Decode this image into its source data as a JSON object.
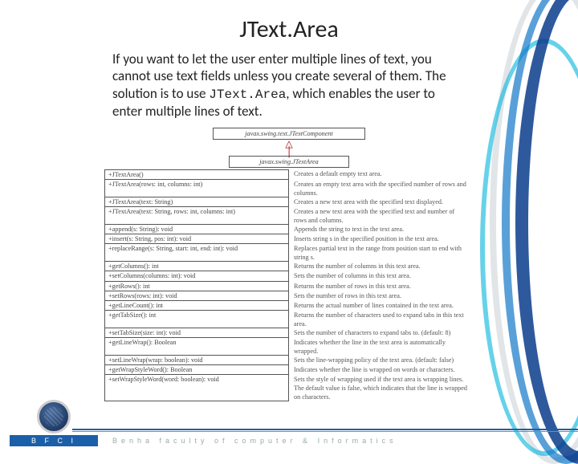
{
  "title": "JText.Area",
  "description_pre": "If you want to let the user enter multiple lines of text, you cannot use text fields unless you create several of them.  The solution is to use ",
  "description_code": "JText.Area",
  "description_post": ", which enables the user to enter multiple lines of text.",
  "superclass": "javax.swing.text.JTextComponent",
  "classname": "javax.swing.JTextArea",
  "uml_header": "JTextArea",
  "rows": [
    {
      "sig": "+JTextArea()",
      "desc": "Creates a default empty text area."
    },
    {
      "sig": "+JTextArea(rows: int, columns: int)",
      "desc": "Creates an empty text area with the specified number of rows and columns."
    },
    {
      "sig": "+JTextArea(text: String)",
      "desc": "Creates a new text area with the specified text displayed."
    },
    {
      "sig": "+JTextArea(text: String, rows: int, columns: int)",
      "desc": "Creates a new text area with the specified text and number of rows and columns."
    },
    {
      "sig": "+append(s: String): void",
      "desc": "Appends the string to text in the text area."
    },
    {
      "sig": "+insert(s: String, pos: int): void",
      "desc": "Inserts string s in the specified position in the text area."
    },
    {
      "sig": "+replaceRange(s: String, start: int, end: int): void",
      "desc": "Replaces partial text in the range from position start to end with string s."
    },
    {
      "sig": "+getColumns(): int",
      "desc": "Returns the number of columns in this text area."
    },
    {
      "sig": "+setColumns(columns: int): void",
      "desc": "Sets the number of columns in this text area."
    },
    {
      "sig": "+getRows(): int",
      "desc": "Returns the number of rows in this text area."
    },
    {
      "sig": "+setRows(rows: int): void",
      "desc": "Sets the number of rows in this text area."
    },
    {
      "sig": "+getLineCount(): int",
      "desc": "Returns the actual number of lines contained in the text area."
    },
    {
      "sig": "+getTabSize(): int",
      "desc": "Returns the number of characters used to expand tabs in this text area."
    },
    {
      "sig": "+setTabSize(size: int): void",
      "desc": "Sets the number of characters to expand tabs to. (default: 8)"
    },
    {
      "sig": "+getLineWrap(): Boolean",
      "desc": "Indicates whether the line in the text area is automatically wrapped."
    },
    {
      "sig": "+setLineWrap(wrap: boolean): void",
      "desc": "Sets the line-wrapping policy of the text area. (default: false)"
    },
    {
      "sig": "+getWrapStyleWord(): Boolean",
      "desc": "Indicates whether the line is wrapped on words or characters."
    },
    {
      "sig": "+setWrapStyleWord(word: boolean): void",
      "desc": "Sets the style of wrapping used if the text area is wrapping lines. The default value is false, which indicates that the line is wrapped on characters."
    }
  ],
  "footer_org": "B F C I",
  "footer_text": "Benha  faculty  of  computer  &  Informatics"
}
